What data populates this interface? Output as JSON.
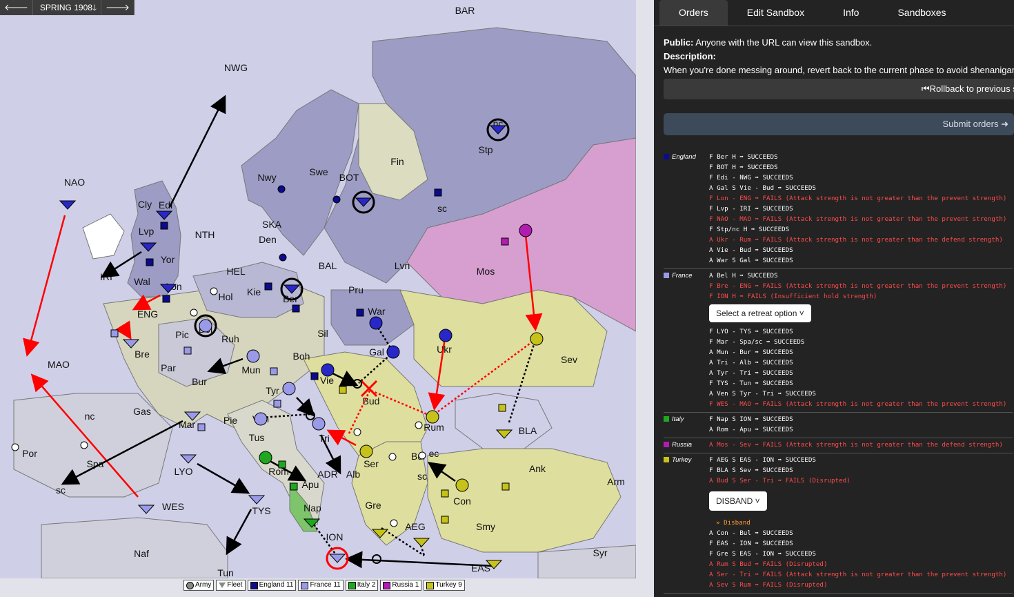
{
  "phase": {
    "label": "SPRING 1908",
    "prev_icon": "left-arrow-icon",
    "next_icon": "right-arrow-icon",
    "dropdown_icon": "down-arrow-icon"
  },
  "map": {
    "labels": [
      "BAR",
      "NWG",
      "NAO",
      "Cly",
      "Edi",
      "Lvp",
      "Yor",
      "NTH",
      "Wal",
      "Lon",
      "IRI",
      "ENG",
      "Nwy",
      "Swe",
      "BOT",
      "Fin",
      "Stp",
      "nc",
      "sc",
      "SKA",
      "Den",
      "HEL",
      "Kie",
      "Ber",
      "Hol",
      "Bel",
      "BAL",
      "Lvn",
      "Pru",
      "War",
      "Mos",
      "Sil",
      "Ruh",
      "Pic",
      "Bre",
      "Par",
      "Mun",
      "Boh",
      "Gal",
      "Ukr",
      "Sev",
      "MAO",
      "Bur",
      "Tyr",
      "Vie",
      "Bud",
      "Rum",
      "Gas",
      "nc",
      "Mar",
      "Pie",
      "Ven",
      "Tri",
      "Ser",
      "Bul",
      "ec",
      "sc",
      "BLA",
      "Ank",
      "Arm",
      "Por",
      "Spa",
      "sc",
      "LYO",
      "Tus",
      "Rom",
      "Apu",
      "ADR",
      "Alb",
      "Gre",
      "Con",
      "Smy",
      "WES",
      "TYS",
      "Nap",
      "ION",
      "AEG",
      "EAS",
      "Syr",
      "Naf",
      "Tun"
    ]
  },
  "legend": [
    {
      "label": "Army",
      "color": "#888888",
      "kind": "army"
    },
    {
      "label": "Fleet",
      "color": "#888888",
      "kind": "fleet"
    },
    {
      "label": "England 11",
      "color": "#0b0b8c"
    },
    {
      "label": "France 11",
      "color": "#9a9ae8"
    },
    {
      "label": "Italy 2",
      "color": "#1fa81f"
    },
    {
      "label": "Russia 1",
      "color": "#b21bb2"
    },
    {
      "label": "Turkey 9",
      "color": "#c6c21a"
    }
  ],
  "tabs": [
    "Orders",
    "Edit Sandbox",
    "Info",
    "Sandboxes"
  ],
  "info": {
    "public_label": "Public:",
    "public_text": " Anyone with the URL can view this sandbox.",
    "description_label": "Description:",
    "description_text": "When you're done messing around, revert back to the current phase to avoid shenanigans",
    "rollback_label": "Rollback to previous se",
    "rollback_icon": "rewind-icon",
    "submit_label": "Submit orders",
    "submit_icon": "arrow-circle-icon"
  },
  "results": [
    {
      "power": "England",
      "color": "#0b0b8c",
      "orders": [
        {
          "t": "F Ber H ➡ SUCCEEDS",
          "f": false
        },
        {
          "t": "F BOT H ➡ SUCCEEDS",
          "f": false
        },
        {
          "t": "F Edi - NWG ➡ SUCCEEDS",
          "f": false
        },
        {
          "t": "A Gal S Vie - Bud ➡ SUCCEEDS",
          "f": false
        },
        {
          "t": "F Lon - ENG ➡ FAILS (Attack strength is not greater than the prevent strength)",
          "f": true
        },
        {
          "t": "F Lvp - IRI ➡ SUCCEEDS",
          "f": false
        },
        {
          "t": "F NAO - MAO ➡ FAILS (Attack strength is not greater than the prevent strength)",
          "f": true
        },
        {
          "t": "F Stp/nc H ➡ SUCCEEDS",
          "f": false
        },
        {
          "t": "A Ukr - Rum ➡ FAILS (Attack strength is not greater than the defend strength)",
          "f": true
        },
        {
          "t": "A Vie - Bud ➡ SUCCEEDS",
          "f": false
        },
        {
          "t": "A War S Gal ➡ SUCCEEDS",
          "f": false
        }
      ]
    },
    {
      "power": "France",
      "color": "#9a9ae8",
      "orders": [
        {
          "t": "A Bel H ➡ SUCCEEDS",
          "f": false
        },
        {
          "t": "F Bre - ENG ➡ FAILS (Attack strength is not greater than the prevent strength)",
          "f": true
        },
        {
          "t": "F ION H ➡ FAILS (Insufficient hold strength)",
          "f": true
        },
        {
          "select": "Select a retreat option"
        },
        {
          "t": "F LYO - TYS ➡ SUCCEEDS",
          "f": false
        },
        {
          "t": "F Mar - Spa/sc ➡ SUCCEEDS",
          "f": false
        },
        {
          "t": "A Mun - Bur ➡ SUCCEEDS",
          "f": false
        },
        {
          "t": "A Tri - Alb ➡ SUCCEEDS",
          "f": false
        },
        {
          "t": "A Tyr - Tri ➡ SUCCEEDS",
          "f": false
        },
        {
          "t": "F TYS - Tun ➡ SUCCEEDS",
          "f": false
        },
        {
          "t": "A Ven S Tyr - Tri ➡ SUCCEEDS",
          "f": false
        },
        {
          "t": "F WES - MAO ➡ FAILS (Attack strength is not greater than the prevent strength)",
          "f": true
        }
      ]
    },
    {
      "power": "Italy",
      "color": "#1fa81f",
      "orders": [
        {
          "t": "F Nap S ION ➡ SUCCEEDS",
          "f": false
        },
        {
          "t": "A Rom - Apu ➡ SUCCEEDS",
          "f": false
        }
      ]
    },
    {
      "power": "Russia",
      "color": "#b21bb2",
      "orders": [
        {
          "t": "A Mos - Sev ➡ FAILS (Attack strength is not greater than the defend strength)",
          "f": true
        }
      ]
    },
    {
      "power": "Turkey",
      "color": "#c6c21a",
      "orders": [
        {
          "t": "F AEG S EAS - ION ➡ SUCCEEDS",
          "f": false
        },
        {
          "t": "F BLA S Sev ➡ SUCCEEDS",
          "f": false
        },
        {
          "t": "A Bud S Ser - Tri ➡ FAILS (Disrupted)",
          "f": true
        },
        {
          "select": "DISBAND"
        },
        {
          "t": "» Disband",
          "o": true
        },
        {
          "t": "A Con - Bul ➡ SUCCEEDS",
          "f": false
        },
        {
          "t": "F EAS - ION ➡ SUCCEEDS",
          "f": false
        },
        {
          "t": "F Gre S EAS - ION ➡ SUCCEEDS",
          "f": false
        },
        {
          "t": "A Rum S Bud ➡ FAILS (Disrupted)",
          "f": true
        },
        {
          "t": "A Ser - Tri ➡ FAILS (Attack strength is not greater than the prevent strength)",
          "f": true
        },
        {
          "t": "A Sev S Rum ➡ FAILS (Disrupted)",
          "f": true
        }
      ]
    }
  ]
}
